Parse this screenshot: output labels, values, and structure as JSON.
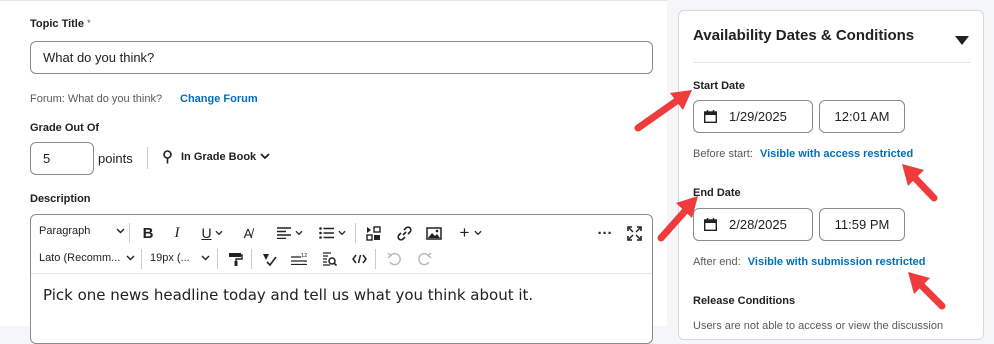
{
  "topic": {
    "title_label": "Topic Title",
    "required_mark": "*",
    "title_value": "What do you think?",
    "forum_text": "Forum: What do you think?",
    "change_forum": "Change Forum"
  },
  "grade": {
    "label": "Grade Out Of",
    "value": "5",
    "unit": "points",
    "gradebook": "In Grade Book"
  },
  "description": {
    "label": "Description",
    "toolbar": {
      "paragraph": "Paragraph",
      "font": "Lato (Recomm...",
      "size": "19px (..."
    },
    "body": "Pick one news headline today and tell us what you think about it."
  },
  "availability": {
    "title": "Availability Dates & Conditions",
    "start_label": "Start Date",
    "start_date": "1/29/2025",
    "start_time": "12:01 AM",
    "before_text": "Before start:",
    "before_link": "Visible with access restricted",
    "end_label": "End Date",
    "end_date": "2/28/2025",
    "end_time": "11:59 PM",
    "after_text": "After end:",
    "after_link": "Visible with submission restricted",
    "release_label": "Release Conditions",
    "release_text": "Users are not able to access or view the discussion"
  },
  "colors": {
    "link": "#006fbf",
    "annotation_arrow": "#ef3b3b"
  }
}
